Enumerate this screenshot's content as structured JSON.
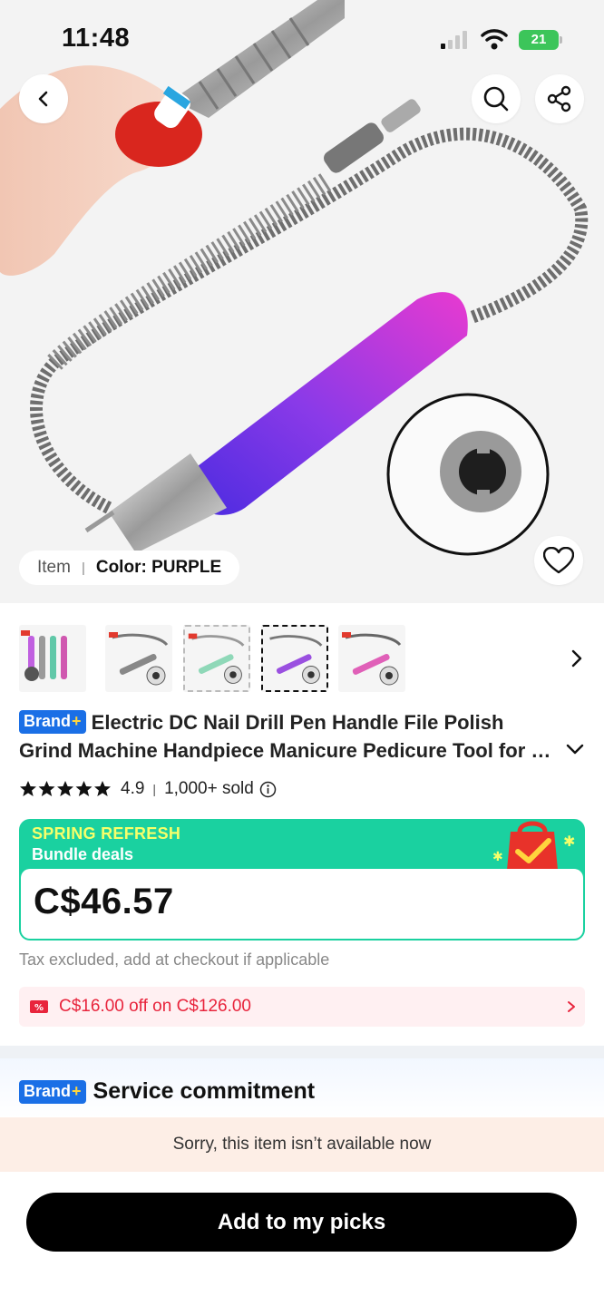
{
  "status_bar": {
    "time": "11:48",
    "battery": "21"
  },
  "gallery": {
    "variant_label": "Item",
    "variant_value": "Color: PURPLE"
  },
  "thumbnails": [
    {
      "name": "thumb-all-colors"
    },
    {
      "name": "thumb-gray"
    },
    {
      "name": "thumb-green"
    },
    {
      "name": "thumb-purple",
      "selected": true
    },
    {
      "name": "thumb-pink"
    }
  ],
  "product": {
    "brand_badge": "Brand",
    "brand_plus": "+",
    "title_line1": "Electric DC Nail Drill Pen Handle File Polish",
    "title_line2": "Grind Machine Handpiece Manicure Pedicure Tool for Nail Art",
    "rating": "4.9",
    "stars": 5,
    "sold": "1,000+ sold"
  },
  "price_card": {
    "promo_title": "SPRING REFRESH",
    "promo_subtitle": "Bundle deals",
    "price": "C$46.57"
  },
  "tax_note": "Tax excluded, add at checkout if applicable",
  "coupon": {
    "text": "C$16.00 off on C$126.00"
  },
  "service": {
    "brand_badge": "Brand",
    "brand_plus": "+",
    "label": "Service commitment"
  },
  "availability": "Sorry, this item isn’t available now",
  "cta": {
    "label": "Add to my picks"
  },
  "colors": {
    "brand_blue": "#1a6fe6",
    "promo_green": "#1ad1a0",
    "coupon_red": "#e8243c",
    "cta_black": "#000000"
  }
}
